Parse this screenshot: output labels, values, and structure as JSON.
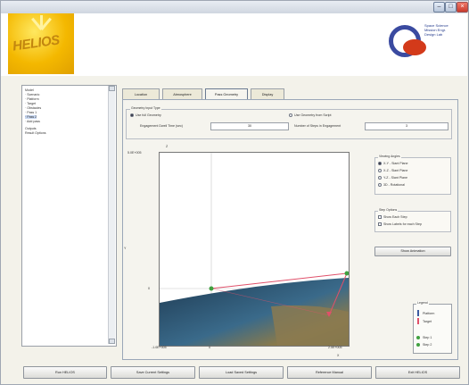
{
  "window": {
    "icons": [
      "minimize-icon",
      "maximize-icon",
      "close-icon"
    ]
  },
  "header": {
    "left_logo": "HELIOS",
    "right_logo_lines": [
      "Space Science",
      "Mission Engr.",
      "Design Lab"
    ]
  },
  "tree": {
    "items": [
      {
        "label": "Model"
      },
      {
        "label": "· Scenario"
      },
      {
        "label": "· Platform"
      },
      {
        "label": "· Target"
      },
      {
        "label": "· Obstacles"
      },
      {
        "label": "· Pass 1"
      },
      {
        "label": "· Pass 2"
      },
      {
        "label": "· Add pass"
      },
      {
        "label": "Outputs"
      },
      {
        "label": "Result Options"
      }
    ],
    "selected_index": 6
  },
  "tabs": [
    {
      "label": "Location"
    },
    {
      "label": "Atmosphere"
    },
    {
      "label": "Pass Geometry"
    },
    {
      "label": "Display"
    }
  ],
  "active_tab_index": 2,
  "geometry_input": {
    "group_label": "Geometry Input Type",
    "option1_label": "Use full Geometry",
    "option2_label": "Use Geometry from Script",
    "engagement_label": "Engagement Dwell Time (sec)",
    "engagement_value": "30",
    "steps_label": "Number of Steps in Engagement",
    "steps_value": "3"
  },
  "viewing_angles": {
    "group_label": "Viewing Angles",
    "items": [
      {
        "label": "X-Y - Slant Plane"
      },
      {
        "label": "X-Z - Slant Plane"
      },
      {
        "label": "Y-Z - Slant Plane"
      },
      {
        "label": "3D - Rotational"
      }
    ]
  },
  "step_options": {
    "group_label": "Step Options",
    "items": [
      {
        "label": "Show Each Step"
      },
      {
        "label": "Show Labels for each Step"
      }
    ]
  },
  "buttons": {
    "show_animation": "Show Animation",
    "bottom": [
      {
        "label": "Run HELIOS"
      },
      {
        "label": "Save Current Settings"
      },
      {
        "label": "Load Saved Settings"
      },
      {
        "label": "Reference Manual"
      },
      {
        "label": "Exit HELIOS"
      }
    ]
  },
  "legend": {
    "title": "Legend",
    "entries": [
      {
        "label": "Platform"
      },
      {
        "label": "Target"
      },
      {
        "label": "Step 1"
      },
      {
        "label": "Step 2"
      }
    ]
  },
  "plot": {
    "y_top_tick": "5.0E+005",
    "y_mid_tick": "0",
    "x_left_tick": "-1.0E+005",
    "x_mid_tick": "0",
    "x_right_tick": "2.0E+005",
    "z_label": "Z",
    "y_axis_label": "Y",
    "x_axis_label": "X",
    "colors": {
      "earth": "#3a6a8a",
      "path": "#e0506a",
      "step": "#40a040"
    }
  }
}
